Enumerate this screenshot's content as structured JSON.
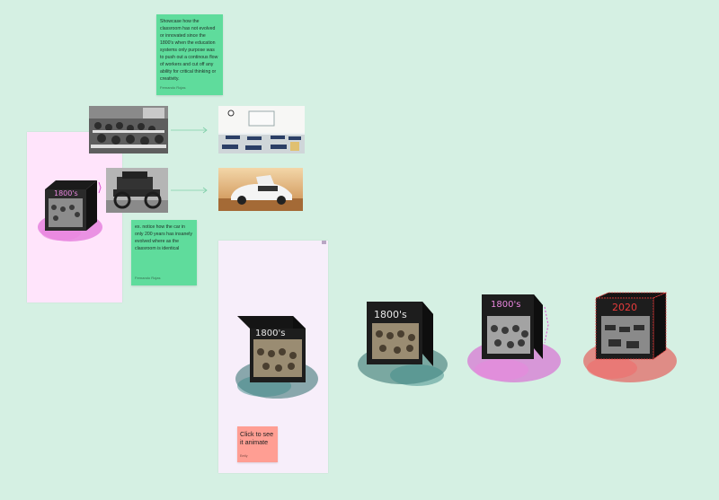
{
  "notes": {
    "top": {
      "text": "Showcase how the classroom has not evolved or innovated since the 1800's when the education systems only purpose was to push out a continous flow of workers and cut off any ability for critical thinking or creativity.",
      "author": "Fernando Rojas"
    },
    "middle": {
      "text": "ex. notice how the car in only 200 years has insanely evolved where as the classroom is identical",
      "author": "Fernando Rojas"
    },
    "animate": {
      "text": "Click to see it animate",
      "author": "Emily"
    }
  },
  "cubes": {
    "pink_small": {
      "label": "1800's"
    },
    "frame_cube": {
      "label": "1800's"
    },
    "teal": {
      "label": "1800's"
    },
    "magenta": {
      "label": "1800's"
    },
    "red": {
      "label": "2020"
    }
  },
  "colors": {
    "canvas": "#d5f0e3",
    "sticky_green": "#5fdc9c",
    "sticky_coral": "#ff9e93",
    "frame_pink": "#ffe4fb",
    "frame_lilac": "#f7eefa",
    "teal_splash": "#2f6e6c",
    "magenta_splash": "#d94fcf",
    "red_splash": "#e83b3b"
  }
}
